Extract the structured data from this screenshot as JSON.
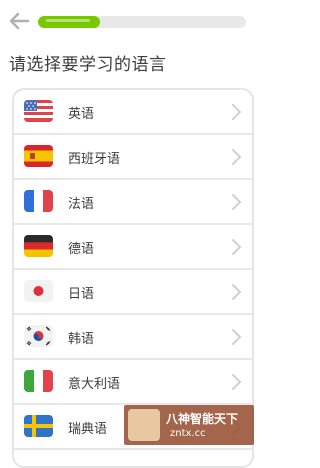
{
  "header": {
    "progress_percent": 30
  },
  "title": "请选择要学习的语言",
  "languages": [
    {
      "label": "英语",
      "flag": "us-flag-icon"
    },
    {
      "label": "西班牙语",
      "flag": "spain-flag-icon"
    },
    {
      "label": "法语",
      "flag": "france-flag-icon"
    },
    {
      "label": "德语",
      "flag": "germany-flag-icon"
    },
    {
      "label": "日语",
      "flag": "japan-flag-icon"
    },
    {
      "label": "韩语",
      "flag": "korea-flag-icon"
    },
    {
      "label": "意大利语",
      "flag": "italy-flag-icon"
    },
    {
      "label": "瑞典语",
      "flag": "sweden-flag-icon"
    }
  ],
  "watermark": {
    "line1": "八神智能天下",
    "line2": "zntx.cc"
  },
  "colors": {
    "progress": "#78c800",
    "text": "#3c3c3c",
    "border": "#e5e5e5"
  }
}
